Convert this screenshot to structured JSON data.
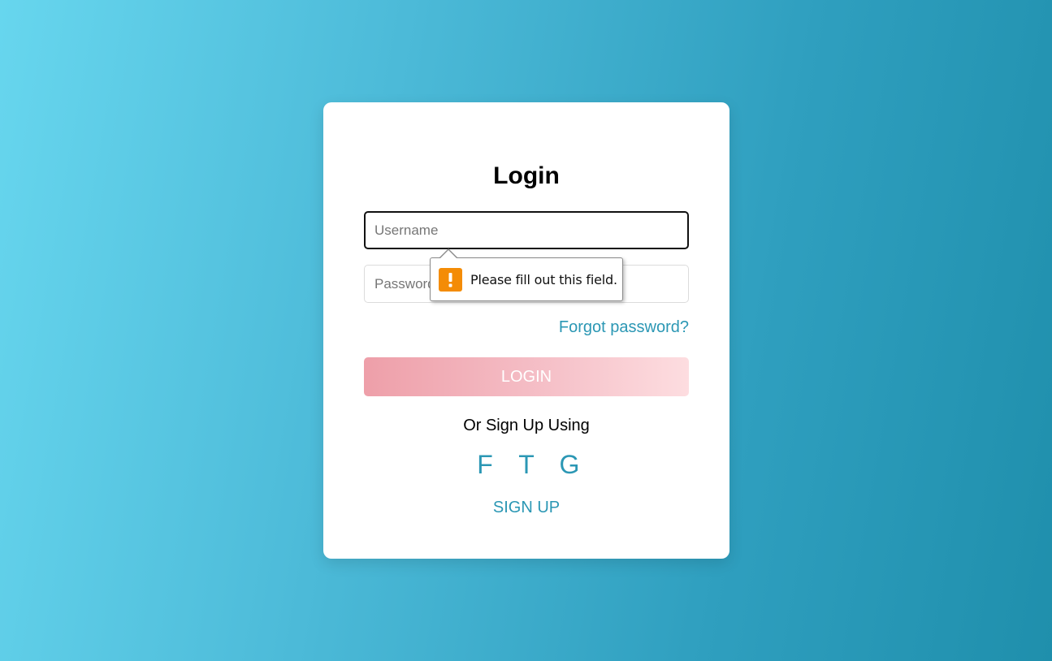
{
  "login": {
    "title": "Login",
    "username_placeholder": "Username",
    "password_placeholder": "Password",
    "forgot_label": "Forgot password?",
    "login_button": "LOGIN",
    "or_text": "Or Sign Up Using",
    "socials": [
      {
        "label": "F",
        "icon": "facebook-icon"
      },
      {
        "label": "T",
        "icon": "twitter-icon"
      },
      {
        "label": "G",
        "icon": "google-icon"
      }
    ],
    "signup_label": "SIGN UP"
  },
  "validation": {
    "message": "Please fill out this field.",
    "icon": "warning-icon",
    "icon_color": "#f48c06"
  },
  "colors": {
    "accent": "#2b97b4",
    "button_gradient_start": "#ee9fa9",
    "button_gradient_end": "#fddde0"
  }
}
